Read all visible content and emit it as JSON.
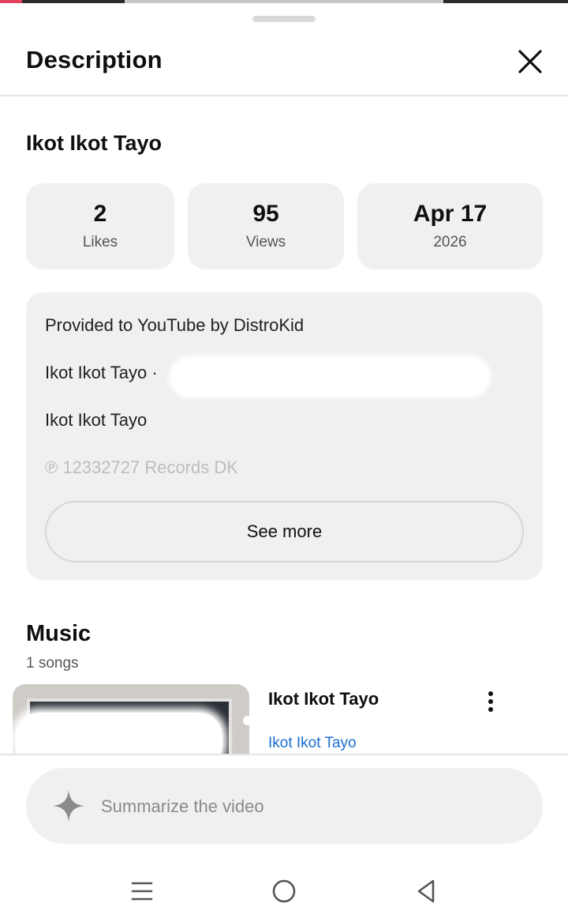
{
  "sheet": {
    "title": "Description"
  },
  "video": {
    "title": "Ikot Ikot Tayo",
    "stats": [
      {
        "value": "2",
        "label": "Likes"
      },
      {
        "value": "95",
        "label": "Views"
      },
      {
        "value": "Apr 17",
        "label": "2026"
      }
    ]
  },
  "description": {
    "lines": [
      "Provided to YouTube by DistroKid",
      "Ikot Ikot Tayo · ",
      "Ikot Ikot Tayo",
      "℗ 12332727 Records DK"
    ],
    "see_more_label": "See more"
  },
  "music": {
    "section_title": "Music",
    "count_text": "1 songs",
    "songs": [
      {
        "title": "Ikot Ikot Tayo",
        "artist": "Ikot Ikot Tayo"
      }
    ]
  },
  "summarize": {
    "label": "Summarize the video",
    "icon": "sparkle-icon"
  },
  "colors": {
    "card_bg": "#f0f0f0",
    "link_blue": "#1a6fcf",
    "muted_text": "#555555"
  },
  "icons": {
    "close": "close-icon",
    "more": "more-vert-icon",
    "nav_menu": "recent-apps-icon",
    "nav_home": "home-icon",
    "nav_back": "back-icon"
  }
}
